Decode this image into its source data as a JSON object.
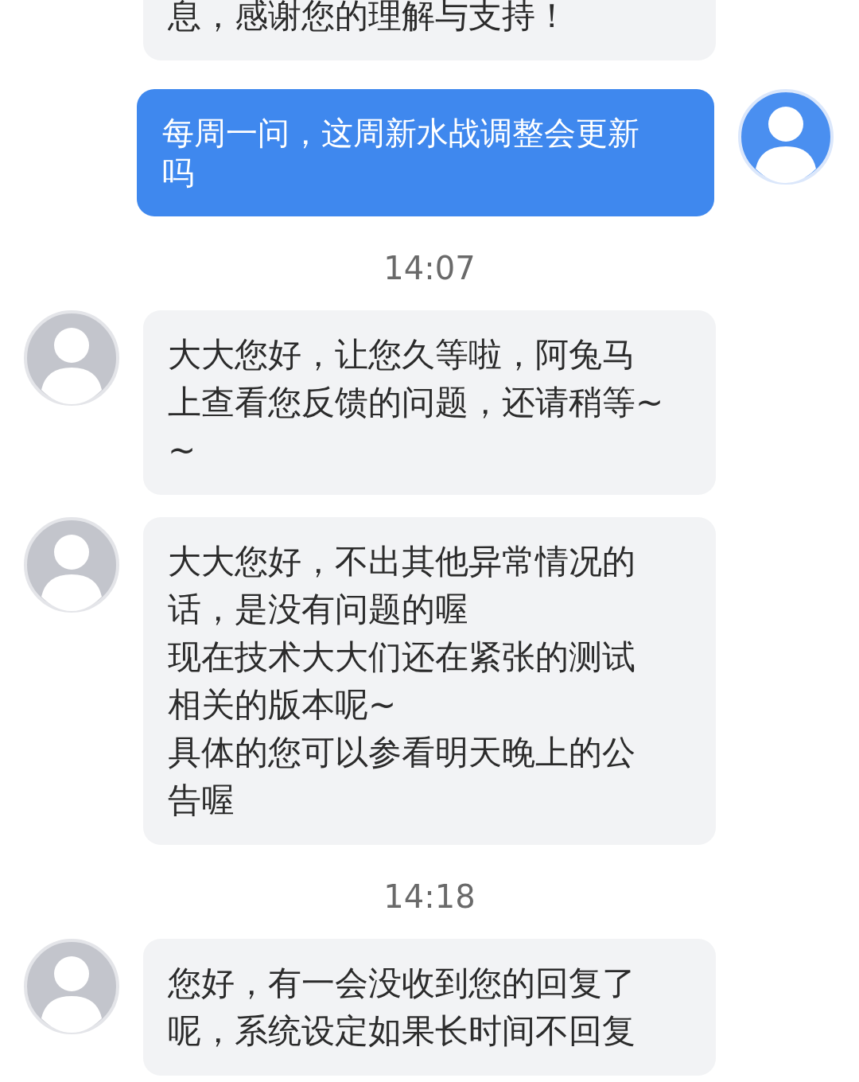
{
  "messages": [
    {
      "kind": "incoming",
      "paragraphs": [
        "息，感谢您的理解与支持！"
      ]
    },
    {
      "kind": "outgoing",
      "paragraphs": [
        "每周一问，这周新水战调整会更新吗"
      ]
    },
    {
      "kind": "time",
      "text": "14:07"
    },
    {
      "kind": "incoming",
      "paragraphs": [
        "大大您好，让您久等啦，阿兔马上查看您反馈的问题，还请稍等~~"
      ]
    },
    {
      "kind": "incoming",
      "paragraphs": [
        "大大您好，不出其他异常情况的话，是没有问题的喔",
        "现在技术大大们还在紧张的测试相关的版本呢~",
        "具体的您可以参看明天晚上的公告喔"
      ]
    },
    {
      "kind": "time",
      "text": "14:18"
    },
    {
      "kind": "incoming",
      "paragraphs": [
        "您好，有一会没收到您的回复了呢，系统设定如果长时间不回复"
      ]
    }
  ]
}
